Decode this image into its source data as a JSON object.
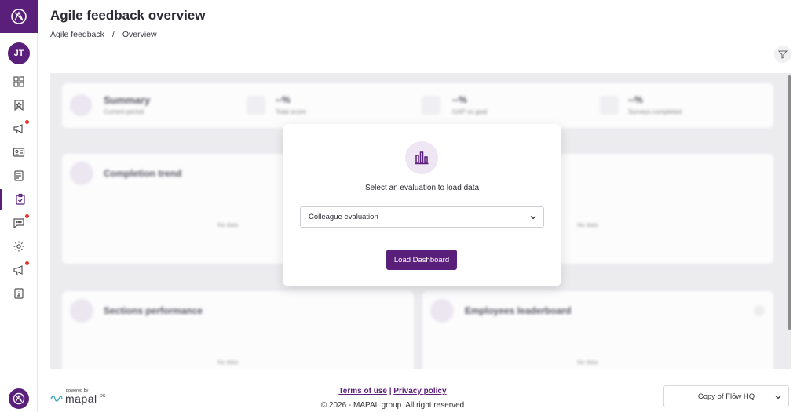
{
  "user": {
    "initials": "JT"
  },
  "page": {
    "title": "Agile feedback overview"
  },
  "breadcrumb": {
    "items": [
      "Agile feedback",
      "/",
      "Overview"
    ]
  },
  "summary": {
    "title": "Summary",
    "subtitle": "Current period",
    "metrics": [
      {
        "value": "--%",
        "label": "Total score",
        "icon": "star-icon"
      },
      {
        "value": "--%",
        "label": "GAP vs goal",
        "icon": "gauge-icon"
      },
      {
        "value": "--%",
        "label": "Surveys completed",
        "icon": "document-icon"
      }
    ]
  },
  "cards": {
    "completion_trend": {
      "title": "Completion trend",
      "empty": "No data"
    },
    "right_top": {
      "empty": "No data"
    },
    "sections_performance": {
      "title": "Sections performance",
      "empty": "No data"
    },
    "employees_leaderboard": {
      "title": "Employees leaderboard",
      "empty": "No data"
    }
  },
  "modal": {
    "prompt": "Select an evaluation to load data",
    "selected_evaluation": "Colleague evaluation",
    "load_button": "Load Dashboard"
  },
  "footer": {
    "powered_by": "powered by",
    "brand": "mapal",
    "brand_suffix": "OS",
    "terms": "Terms of use",
    "separator": "|",
    "privacy": "Privacy policy",
    "copyright": "© 2026 - MAPAL group. All right reserved",
    "organization": "Copy of Flōw HQ"
  },
  "colors": {
    "brand": "#5a1f7a",
    "notification": "#e5332a"
  }
}
